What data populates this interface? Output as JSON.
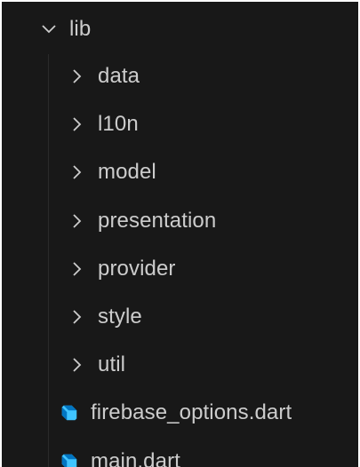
{
  "explorer": {
    "root": {
      "label": "lib",
      "expanded": true
    },
    "folders": [
      {
        "label": "data"
      },
      {
        "label": "l10n"
      },
      {
        "label": "model"
      },
      {
        "label": "presentation"
      },
      {
        "label": "provider"
      },
      {
        "label": "style"
      },
      {
        "label": "util"
      }
    ],
    "files": [
      {
        "label": "firebase_options.dart",
        "icon": "dart-icon"
      },
      {
        "label": "main.dart",
        "icon": "dart-icon"
      }
    ]
  },
  "colors": {
    "background": "#181818",
    "text": "#cccccc",
    "dart_icon_light": "#40c4ff",
    "dart_icon_dark": "#0175c2"
  }
}
